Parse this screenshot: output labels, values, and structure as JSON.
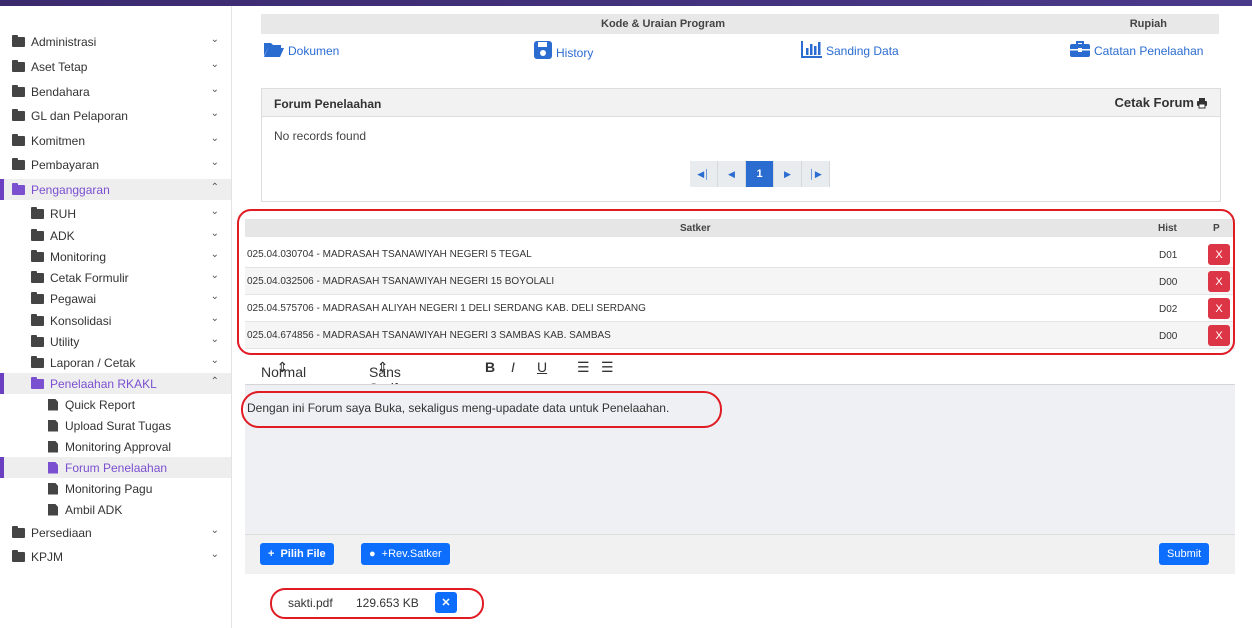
{
  "sidebar": {
    "items": [
      {
        "label": "Administrasi"
      },
      {
        "label": "Aset Tetap"
      },
      {
        "label": "Bendahara"
      },
      {
        "label": "GL dan Pelaporan"
      },
      {
        "label": "Komitmen"
      },
      {
        "label": "Pembayaran"
      },
      {
        "label": "Penganggaran"
      },
      {
        "label": "RUH"
      },
      {
        "label": "ADK"
      },
      {
        "label": "Monitoring"
      },
      {
        "label": "Cetak Formulir"
      },
      {
        "label": "Pegawai"
      },
      {
        "label": "Konsolidasi"
      },
      {
        "label": "Utility"
      },
      {
        "label": "Laporan / Cetak"
      },
      {
        "label": "Penelaahan RKAKL"
      },
      {
        "label": "Quick Report"
      },
      {
        "label": "Upload Surat Tugas"
      },
      {
        "label": "Monitoring Approval"
      },
      {
        "label": "Forum Penelaahan"
      },
      {
        "label": "Monitoring Pagu"
      },
      {
        "label": "Ambil ADK"
      },
      {
        "label": "Persediaan"
      },
      {
        "label": "KPJM"
      }
    ]
  },
  "header": {
    "col1": "Kode & Uraian Program",
    "col2": "Rupiah"
  },
  "links": {
    "dokumen": "Dokumen",
    "history": "History",
    "sanding": "Sanding Data",
    "catatan": "Catatan Penelaahan"
  },
  "forum": {
    "title": "Forum Penelaahan",
    "print": "Cetak Forum",
    "empty": "No records found",
    "page": "1"
  },
  "satker": {
    "headers": {
      "name": "Satker",
      "hist": "Hist",
      "p": "P"
    },
    "rows": [
      {
        "name": "025.04.030704 - MADRASAH TSANAWIYAH NEGERI 5 TEGAL",
        "hist": "D01",
        "del": "X"
      },
      {
        "name": "025.04.032506 - MADRASAH TSANAWIYAH NEGERI 15 BOYOLALI",
        "hist": "D00",
        "del": "X"
      },
      {
        "name": "025.04.575706 - MADRASAH ALIYAH NEGERI 1 DELI SERDANG KAB. DELI SERDANG",
        "hist": "D02",
        "del": "X"
      },
      {
        "name": "025.04.674856 - MADRASAH TSANAWIYAH NEGERI 3 SAMBAS KAB. SAMBAS",
        "hist": "D00",
        "del": "X"
      }
    ]
  },
  "editor": {
    "format": "Normal",
    "font": "Sans Serif",
    "bold": "B",
    "italic": "I",
    "underline": "U",
    "content": "Dengan ini Forum saya Buka, sekaligus meng-upadate data untuk Penelaahan."
  },
  "buttons": {
    "pilih": "Pilih File",
    "rev": "+Rev.Satker",
    "submit": "Submit"
  },
  "file": {
    "name": "sakti.pdf",
    "size": "129.653 KB"
  }
}
